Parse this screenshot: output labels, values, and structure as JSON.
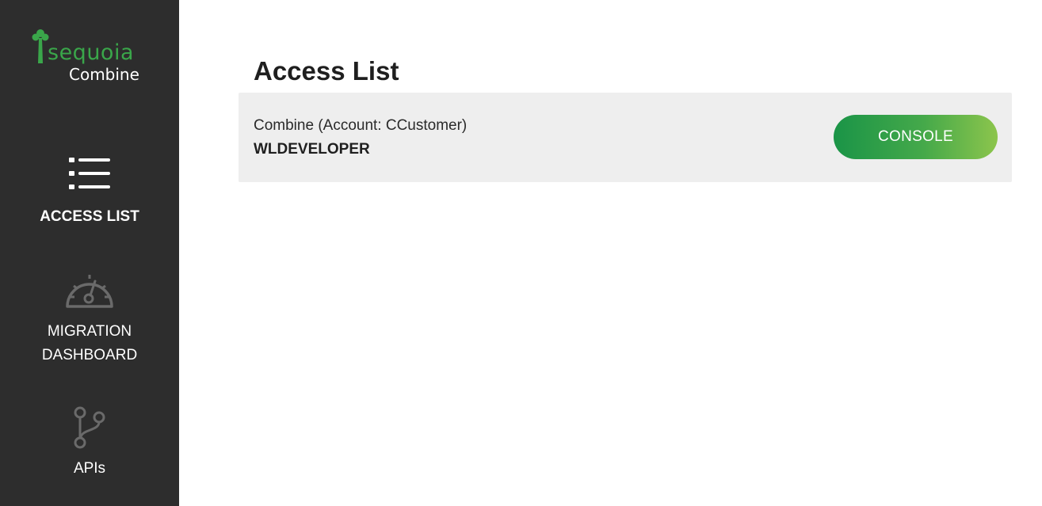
{
  "brand": {
    "name": "sequoia",
    "product": "Combine",
    "colors": {
      "green": "#3aa64a",
      "sidebar_bg": "#2d2d2d"
    }
  },
  "sidebar": {
    "items": [
      {
        "label": "ACCESS LIST",
        "icon": "list-icon",
        "active": true
      },
      {
        "label_line1": "MIGRATION",
        "label_line2": "DASHBOARD",
        "icon": "gauge-icon",
        "active": false
      },
      {
        "label": "APIs",
        "icon": "branch-icon",
        "active": false
      }
    ]
  },
  "main": {
    "title": "Access List",
    "entries": [
      {
        "account_text": "Combine (Account: CCustomer)",
        "user": "WLDEVELOPER",
        "button_label": "CONSOLE"
      }
    ]
  },
  "colors": {
    "button_gradient_start": "#1a9447",
    "button_gradient_end": "#8cc54c",
    "card_bg": "#eeeeee"
  }
}
